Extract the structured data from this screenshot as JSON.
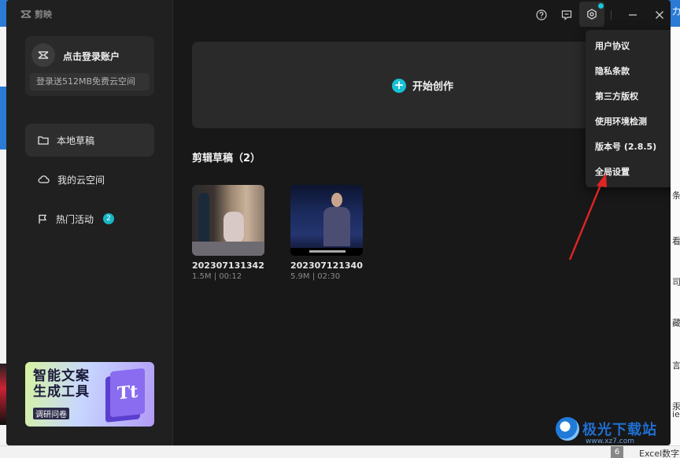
{
  "app": {
    "logo_text": "剪映"
  },
  "account": {
    "login_label": "点击登录账户",
    "cloud_promo": "登录送512MB免费云空间"
  },
  "sidebar": {
    "items": [
      {
        "label": "本地草稿",
        "icon": "folder-icon"
      },
      {
        "label": "我的云空间",
        "icon": "cloud-icon"
      },
      {
        "label": "热门活动",
        "icon": "flag-icon",
        "badge": "2"
      }
    ]
  },
  "promo_card": {
    "title_line1": "智能文案",
    "title_line2": "生成工具",
    "subtitle": "调研问卷",
    "graphic_text": "Tt"
  },
  "main": {
    "create_label": "开始创作",
    "drafts_title": "剪辑草稿（2）",
    "drafts": [
      {
        "name": "202307131342",
        "meta": "1.5M | 00:12"
      },
      {
        "name": "202307121340",
        "meta": "5.9M | 02:30"
      }
    ]
  },
  "menu": {
    "items": [
      {
        "label": "用户协议"
      },
      {
        "label": "隐私条款"
      },
      {
        "label": "第三方版权"
      },
      {
        "label": "使用环境检测"
      },
      {
        "label": "版本号 (2.8.5)"
      },
      {
        "label": "全局设置"
      }
    ]
  },
  "watermark": {
    "brand": "极光下载站",
    "url": "www.xz7.com"
  },
  "background": {
    "taskbar_tag": "6",
    "taskbar_text": "Excel数字",
    "right_glyphs": [
      "力",
      "条",
      "看",
      "司",
      "藏",
      "言",
      "汞",
      "ie"
    ]
  },
  "colors": {
    "accent": "#16c1d3",
    "annotation_arrow": "#e02424",
    "window_bg": "#181818",
    "sidebar_bg": "#202020"
  }
}
